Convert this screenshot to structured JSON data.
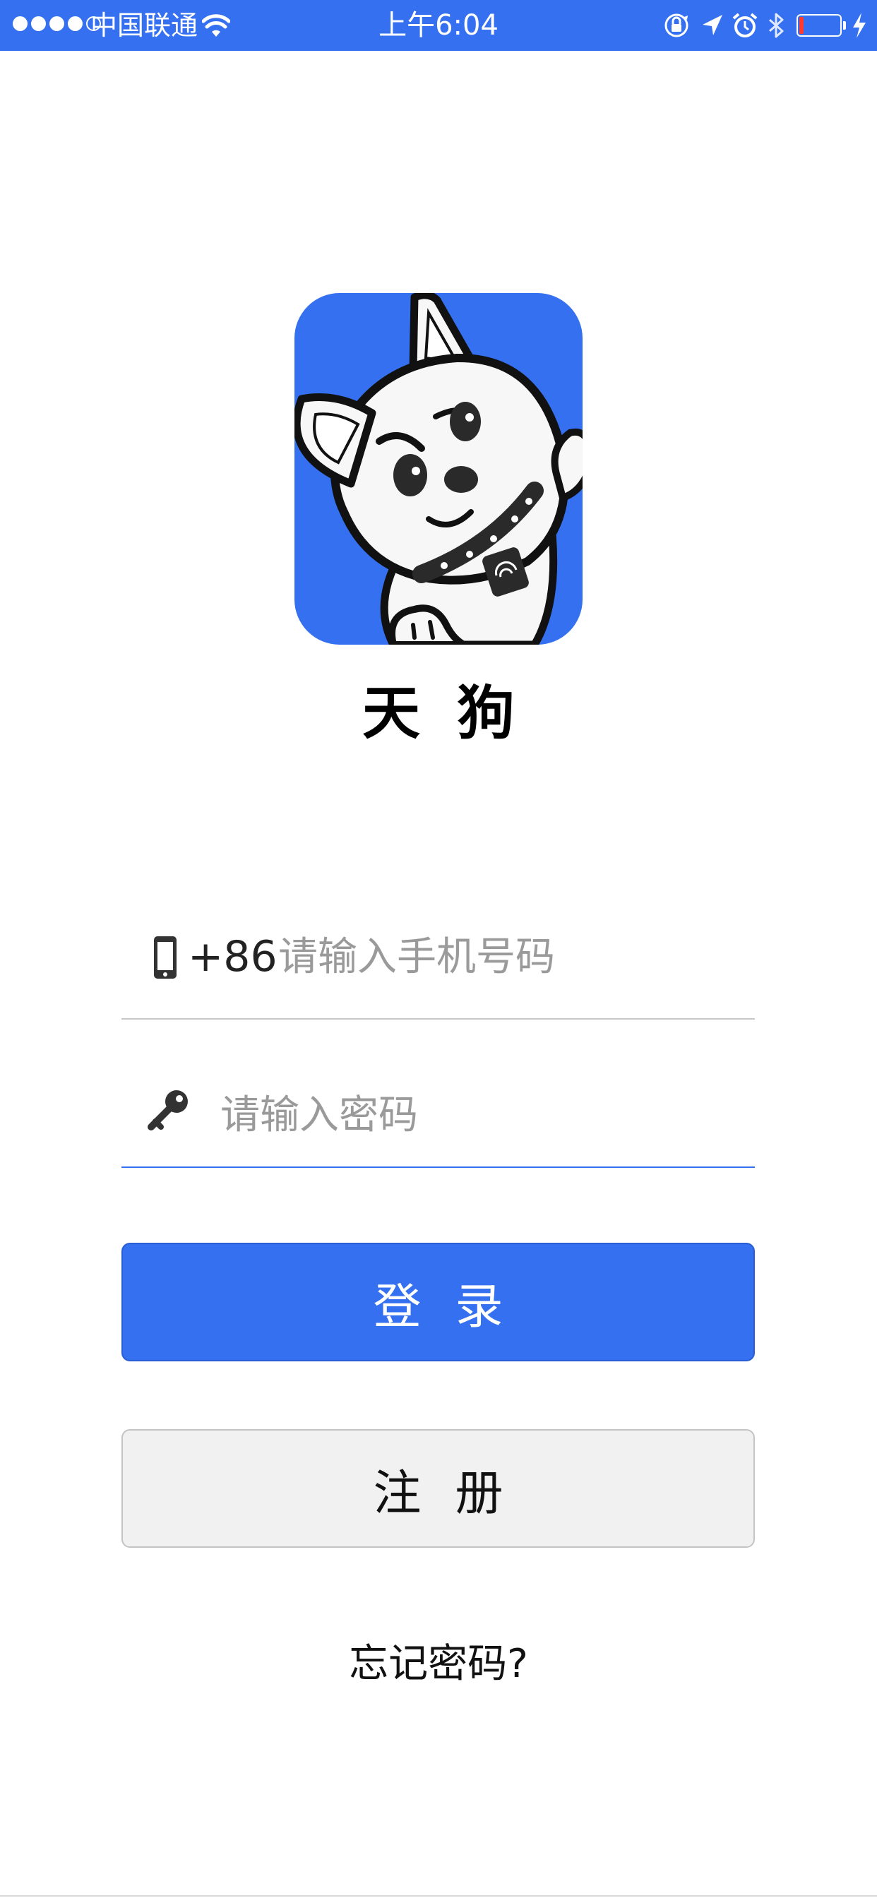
{
  "status_bar": {
    "carrier": "中国联通",
    "time": "上午6:04",
    "signal_bars": 4,
    "signal_total": 5,
    "battery_level": 0.1,
    "icons": [
      "wifi-icon",
      "orientation-lock-icon",
      "location-icon",
      "alarm-icon",
      "bluetooth-icon",
      "battery-icon",
      "charging-icon"
    ],
    "background": "#3470ef"
  },
  "logo": {
    "icon": "dog-mascot-icon",
    "app_name": "天狗",
    "background": "#3470ef"
  },
  "phone_field": {
    "icon": "phone-icon",
    "country_code": "+86",
    "placeholder": "请输入手机号码",
    "value": ""
  },
  "password_field": {
    "icon": "key-icon",
    "placeholder": "请输入密码",
    "value": ""
  },
  "login_button": {
    "label": "登录",
    "color": "#3470ef"
  },
  "register_button": {
    "label": "注册",
    "color": "#f1f1f1"
  },
  "forgot_password": {
    "label": "忘记密码?"
  }
}
